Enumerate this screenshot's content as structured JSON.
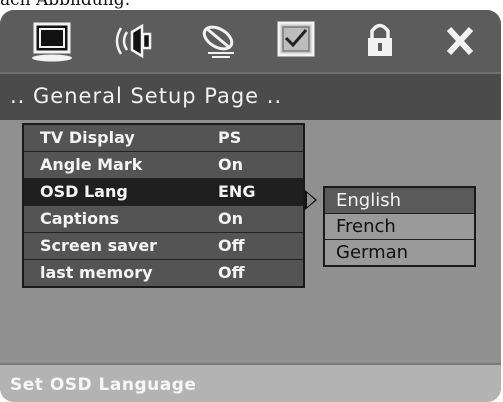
{
  "caption_top": "ach Abbildung:",
  "page_title": ".. General Setup Page ..",
  "icons": [
    "tv-display-icon",
    "speaker-audio-icon",
    "dolby-satellite-icon",
    "checkbox-preferences-icon",
    "lock-icon",
    "close-icon"
  ],
  "menu": {
    "items": [
      {
        "label": "TV Display",
        "value": "PS"
      },
      {
        "label": "Angle Mark",
        "value": "On"
      },
      {
        "label": "OSD Lang",
        "value": "ENG"
      },
      {
        "label": "Captions",
        "value": "On"
      },
      {
        "label": "Screen saver",
        "value": "Off"
      },
      {
        "label": "last memory",
        "value": "Off"
      }
    ],
    "selected_index": 2
  },
  "submenu": {
    "options": [
      "English",
      "French",
      "German"
    ],
    "selected_index": 0
  },
  "footer": {
    "hint": "Set OSD Language"
  },
  "colors": {
    "panel_bg": "#909090",
    "iconbar_bg": "#5c5c5c",
    "title_bg": "#4b4b4b",
    "menu_bg": "#545454",
    "selected_row": "#1f1f1f",
    "footer_bg": "#b3b3b3"
  }
}
